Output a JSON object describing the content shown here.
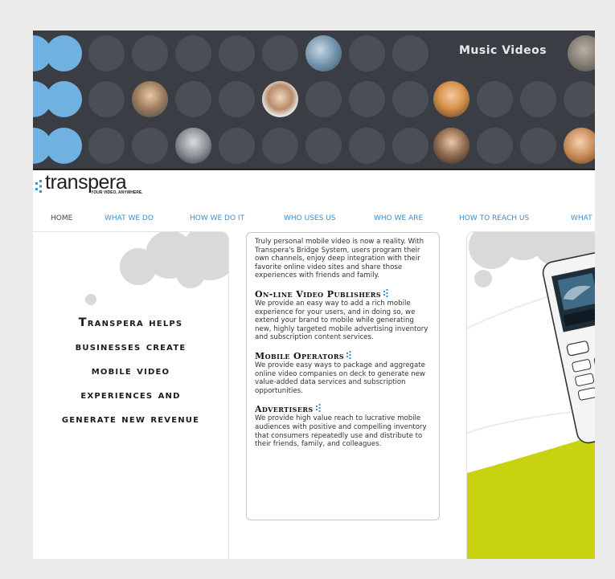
{
  "banner": {
    "caption": "Music Videos",
    "accent_dot_color": "#6fb1e0",
    "dark_dot_color": "#4a4f56",
    "background_color": "#3a3e44"
  },
  "brand": {
    "name": "transpera",
    "tagline": "YOUR VIDEO, ANYWHERE.",
    "accent_color": "#3a8fd0"
  },
  "nav": {
    "items": [
      {
        "label": "HOME",
        "active": true
      },
      {
        "label": "WHAT WE DO",
        "active": false
      },
      {
        "label": "HOW WE DO IT",
        "active": false
      },
      {
        "label": "WHO USES US",
        "active": false
      },
      {
        "label": "WHO WE ARE",
        "active": false
      },
      {
        "label": "HOW TO REACH US",
        "active": false
      },
      {
        "label": "WHAT",
        "active": false
      }
    ]
  },
  "hero": {
    "lines": [
      "Transpera helps",
      "businesses create",
      "mobile video",
      "experiences and",
      "generate new revenue"
    ]
  },
  "content": {
    "intro": "Truly personal mobile video is now a reality. With Transpera's Bridge System, users program their own channels, enjoy deep integration with their favorite online video sites and share those experiences with friends and family.",
    "sections": [
      {
        "title": "On-line Video Publishers",
        "body": "We provide an easy way to add a rich mobile experience for your users, and in doing so, we extend your brand to mobile while generating new, highly targeted mobile advertising inventory and subscription content services."
      },
      {
        "title": "Mobile Operators",
        "body": "We provide easy ways to package and aggregate online video companies on deck to generate new value-added data services and subscription opportunities."
      },
      {
        "title": "Advertisers",
        "body": "We provide high value reach to lucrative mobile audiences with positive and compelling inventory that consumers repeatedly use and distribute to their friends, family, and colleagues."
      }
    ]
  },
  "right_panel": {
    "accent_color": "#c8d20f",
    "image": "phone-illustration"
  }
}
